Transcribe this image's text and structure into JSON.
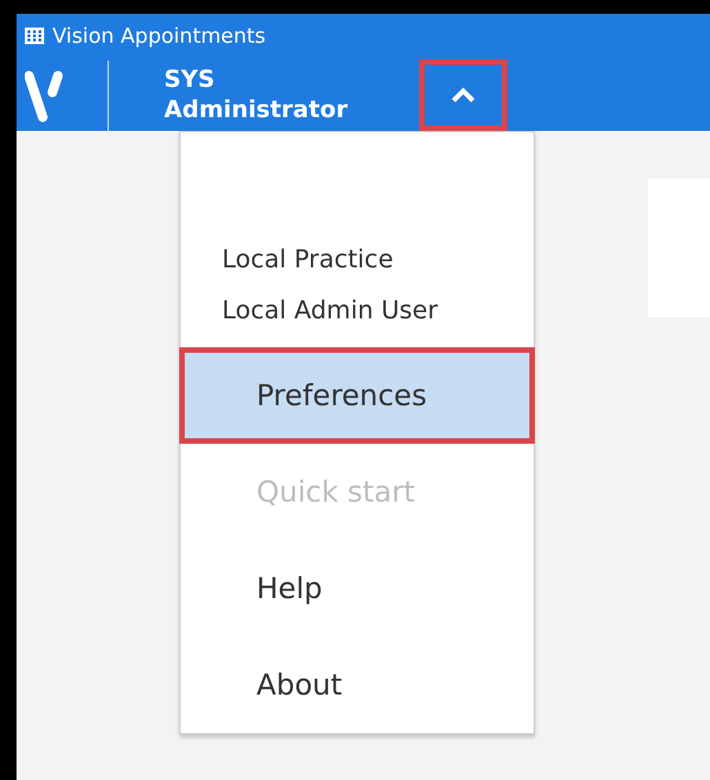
{
  "window": {
    "title": "Vision Appointments"
  },
  "header": {
    "user_name": "SYS Administrator",
    "menu_button": {
      "expanded": true,
      "annotated": true
    }
  },
  "user_menu": {
    "info": [
      "Local Practice",
      "Local Admin User"
    ],
    "items": [
      {
        "label": "Preferences",
        "selected": true,
        "disabled": false,
        "annotated": true
      },
      {
        "label": "Quick start",
        "selected": false,
        "disabled": true,
        "annotated": false
      },
      {
        "label": "Help",
        "selected": false,
        "disabled": false,
        "annotated": false
      },
      {
        "label": "About",
        "selected": false,
        "disabled": false,
        "annotated": false
      }
    ]
  }
}
